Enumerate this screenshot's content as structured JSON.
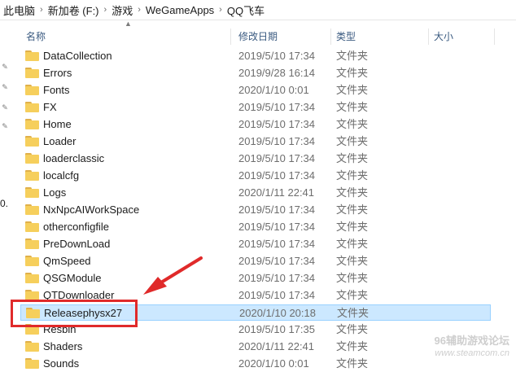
{
  "breadcrumb": [
    "此电脑",
    "新加卷 (F:)",
    "游戏",
    "WeGameApps",
    "QQ飞车"
  ],
  "breadcrumb_separator": "›",
  "columns": {
    "name": "名称",
    "date": "修改日期",
    "type": "类型",
    "size": "大小"
  },
  "nav_partial_text": "0.",
  "files": [
    {
      "name": "DataCollection",
      "date": "2019/5/10 17:34",
      "type": "文件夹"
    },
    {
      "name": "Errors",
      "date": "2019/9/28 16:14",
      "type": "文件夹"
    },
    {
      "name": "Fonts",
      "date": "2020/1/10 0:01",
      "type": "文件夹"
    },
    {
      "name": "FX",
      "date": "2019/5/10 17:34",
      "type": "文件夹"
    },
    {
      "name": "Home",
      "date": "2019/5/10 17:34",
      "type": "文件夹"
    },
    {
      "name": "Loader",
      "date": "2019/5/10 17:34",
      "type": "文件夹"
    },
    {
      "name": "loaderclassic",
      "date": "2019/5/10 17:34",
      "type": "文件夹"
    },
    {
      "name": "localcfg",
      "date": "2019/5/10 17:34",
      "type": "文件夹"
    },
    {
      "name": "Logs",
      "date": "2020/1/11 22:41",
      "type": "文件夹"
    },
    {
      "name": "NxNpcAIWorkSpace",
      "date": "2019/5/10 17:34",
      "type": "文件夹"
    },
    {
      "name": "otherconfigfile",
      "date": "2019/5/10 17:34",
      "type": "文件夹"
    },
    {
      "name": "PreDownLoad",
      "date": "2019/5/10 17:34",
      "type": "文件夹"
    },
    {
      "name": "QmSpeed",
      "date": "2019/5/10 17:34",
      "type": "文件夹"
    },
    {
      "name": "QSGModule",
      "date": "2019/5/10 17:34",
      "type": "文件夹"
    },
    {
      "name": "QTDownloader",
      "date": "2019/5/10 17:34",
      "type": "文件夹"
    },
    {
      "name": "Releasephysx27",
      "date": "2020/1/10 20:18",
      "type": "文件夹",
      "selected": true
    },
    {
      "name": "Resbin",
      "date": "2019/5/10 17:35",
      "type": "文件夹"
    },
    {
      "name": "Shaders",
      "date": "2020/1/11 22:41",
      "type": "文件夹"
    },
    {
      "name": "Sounds",
      "date": "2020/1/10 0:01",
      "type": "文件夹"
    }
  ],
  "watermark": {
    "line1": "96辅助游戏论坛",
    "line2": "www.steamcom.cn"
  },
  "colors": {
    "selected_bg": "#cce8ff",
    "annotation_red": "#e02a2a",
    "folder_yellow": "#f6cf5c"
  }
}
